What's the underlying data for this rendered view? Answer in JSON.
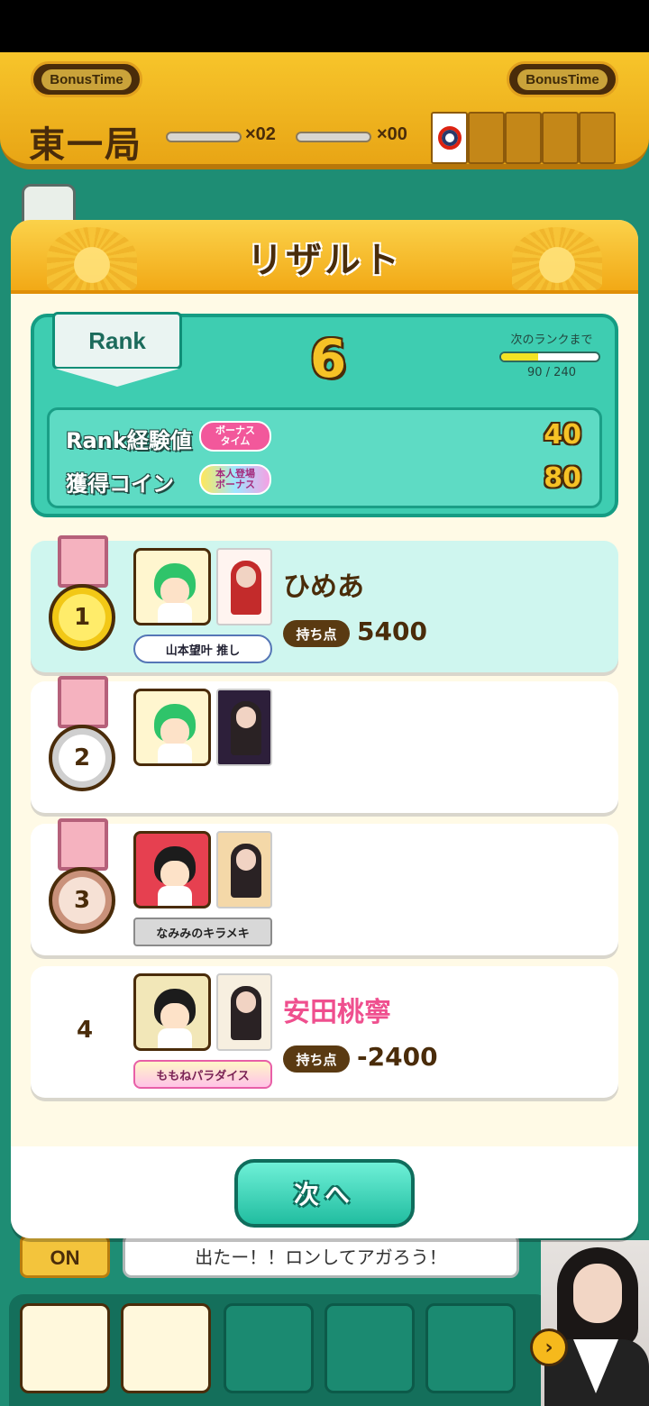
{
  "header": {
    "bonus_left": "BonusTime",
    "bonus_right": "BonusTime",
    "round": "東一局",
    "honba_count": "×02",
    "riichi_count": "×00"
  },
  "modal": {
    "title": "リザルト",
    "rank": {
      "label": "Rank",
      "value": "6",
      "next_label": "次のランクまで",
      "progress_text": "90 / 240",
      "progress_fraction": 0.375
    },
    "rewards": [
      {
        "label": "Rank経験値",
        "tag": "ボーナス\nタイム",
        "value": "40"
      },
      {
        "label": "獲得コイン",
        "tag": "本人登場\nボーナス",
        "value": "80"
      }
    ],
    "players": [
      {
        "rank": "1",
        "name": "ひめあ",
        "points_label": "持ち点",
        "points": "5400",
        "title": "山本望叶 推し"
      },
      {
        "rank": "2",
        "name": "",
        "points_label": "",
        "points": "",
        "title": ""
      },
      {
        "rank": "3",
        "name": "",
        "points_label": "",
        "points": "",
        "title": "なみみのキラメキ"
      },
      {
        "rank": "4",
        "name": "安田桃寧",
        "points_label": "持ち点",
        "points": "-2400",
        "title": "ももねパラダイス"
      }
    ],
    "next_button": "次へ"
  },
  "bottom": {
    "auto_label": "ON",
    "speech": "出たー！！ロンしてアガろう！"
  },
  "colors": {
    "accent_teal": "#3ecdb1",
    "gold": "#f6c226",
    "brown": "#4a2c0a",
    "pink_name": "#ef4f8e"
  }
}
